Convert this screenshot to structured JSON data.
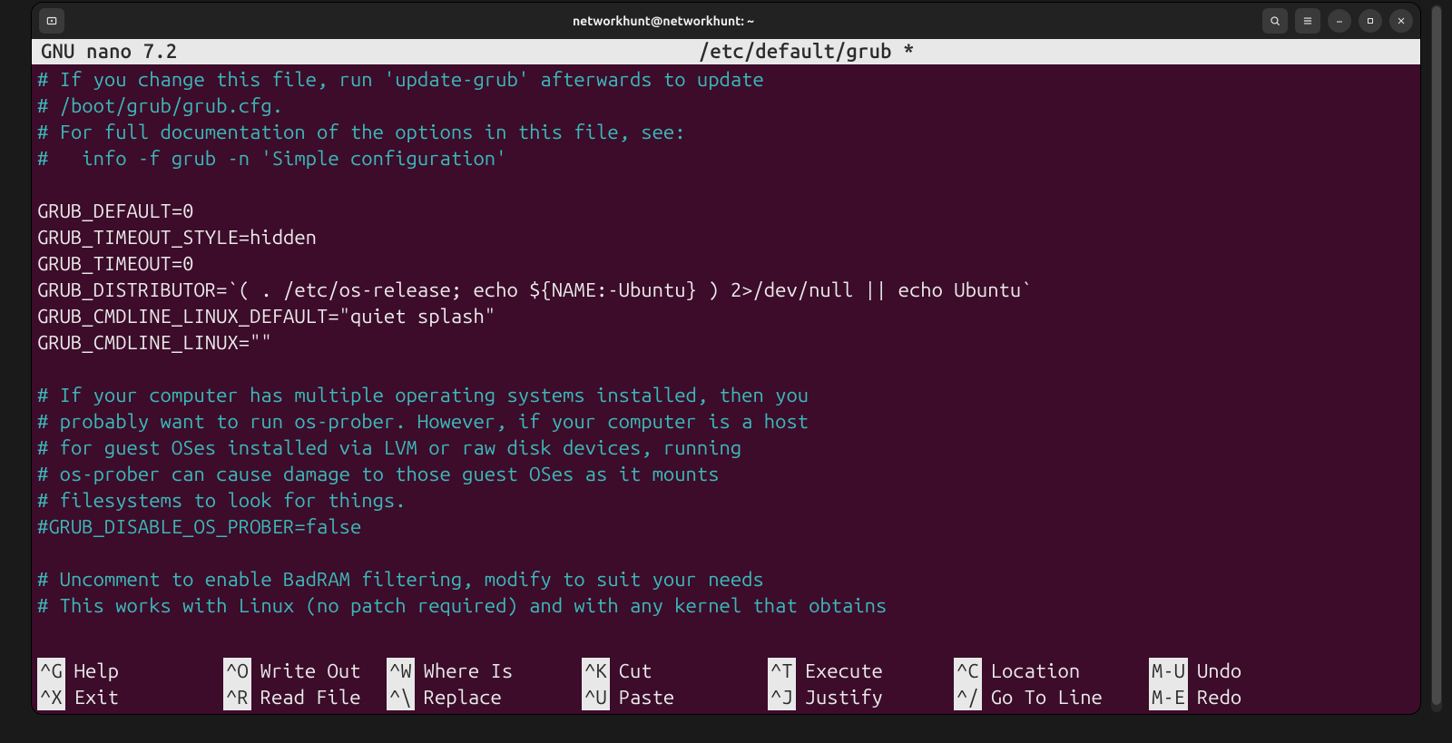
{
  "titlebar": {
    "title": "networkhunt@networkhunt: ~"
  },
  "nano": {
    "app": "GNU nano 7.2",
    "file": "/etc/default/grub *"
  },
  "lines": [
    {
      "cls": "comment",
      "text": "# If you change this file, run 'update-grub' afterwards to update"
    },
    {
      "cls": "comment",
      "text": "# /boot/grub/grub.cfg."
    },
    {
      "cls": "comment",
      "text": "# For full documentation of the options in this file, see:"
    },
    {
      "cls": "comment",
      "text": "#   info -f grub -n 'Simple configuration'"
    },
    {
      "cls": "plain",
      "text": ""
    },
    {
      "cls": "plain",
      "text": "GRUB_DEFAULT=0"
    },
    {
      "cls": "plain",
      "text": "GRUB_TIMEOUT_STYLE=hidden"
    },
    {
      "cls": "plain",
      "text": "GRUB_TIMEOUT=0"
    },
    {
      "cls": "plain",
      "text": "GRUB_DISTRIBUTOR=`( . /etc/os-release; echo ${NAME:-Ubuntu} ) 2>/dev/null || echo Ubuntu`"
    },
    {
      "cls": "plain",
      "text": "GRUB_CMDLINE_LINUX_DEFAULT=\"quiet splash\""
    },
    {
      "cls": "plain",
      "text": "GRUB_CMDLINE_LINUX=\"\""
    },
    {
      "cls": "plain",
      "text": ""
    },
    {
      "cls": "comment",
      "text": "# If your computer has multiple operating systems installed, then you"
    },
    {
      "cls": "comment",
      "text": "# probably want to run os-prober. However, if your computer is a host"
    },
    {
      "cls": "comment",
      "text": "# for guest OSes installed via LVM or raw disk devices, running"
    },
    {
      "cls": "comment",
      "text": "# os-prober can cause damage to those guest OSes as it mounts"
    },
    {
      "cls": "comment",
      "text": "# filesystems to look for things."
    },
    {
      "cls": "comment",
      "text": "#GRUB_DISABLE_OS_PROBER=false"
    },
    {
      "cls": "plain",
      "text": ""
    },
    {
      "cls": "comment",
      "text": "# Uncomment to enable BadRAM filtering, modify to suit your needs"
    },
    {
      "cls": "comment",
      "text": "# This works with Linux (no patch required) and with any kernel that obtains"
    }
  ],
  "shortcuts": {
    "row1": [
      {
        "key": "^G",
        "label": "Help"
      },
      {
        "key": "^O",
        "label": "Write Out"
      },
      {
        "key": "^W",
        "label": "Where Is"
      },
      {
        "key": "^K",
        "label": "Cut"
      },
      {
        "key": "^T",
        "label": "Execute"
      },
      {
        "key": "^C",
        "label": "Location"
      },
      {
        "key": "M-U",
        "label": "Undo"
      }
    ],
    "row2": [
      {
        "key": "^X",
        "label": "Exit"
      },
      {
        "key": "^R",
        "label": "Read File"
      },
      {
        "key": "^\\",
        "label": "Replace"
      },
      {
        "key": "^U",
        "label": "Paste"
      },
      {
        "key": "^J",
        "label": "Justify"
      },
      {
        "key": "^/",
        "label": "Go To Line"
      },
      {
        "key": "M-E",
        "label": "Redo"
      }
    ]
  }
}
